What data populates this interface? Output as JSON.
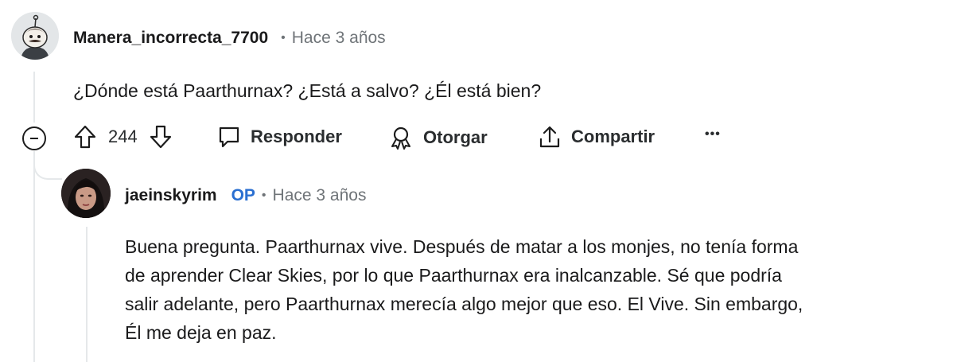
{
  "comment": {
    "author": "Manera_incorrecta_7700",
    "separator": "•",
    "time": "Hace 3 años",
    "text": "¿Dónde está Paarthurnax? ¿Está a salvo? ¿Él está bien?",
    "votes": "244",
    "actions": {
      "reply": "Responder",
      "award": "Otorgar",
      "share": "Compartir",
      "more": "•••"
    }
  },
  "reply": {
    "author": "jaeinskyrim",
    "badge": "OP",
    "separator": "•",
    "time": "Hace 3 años",
    "lines": [
      "Buena pregunta. Paarthurnax vive. Después de matar a los monjes, no tenía forma",
      "de aprender Clear Skies, por lo que Paarthurnax era inalcanzable. Sé que podría",
      "salir adelante, pero Paarthurnax merecía algo mejor que eso. El Vive. Sin embargo,",
      "Él me deja en paz."
    ]
  },
  "icons": [
    "avatar-snoo-icon",
    "upvote-icon",
    "downvote-icon",
    "comment-icon",
    "award-icon",
    "share-icon",
    "more-icon",
    "collapse-icon"
  ]
}
